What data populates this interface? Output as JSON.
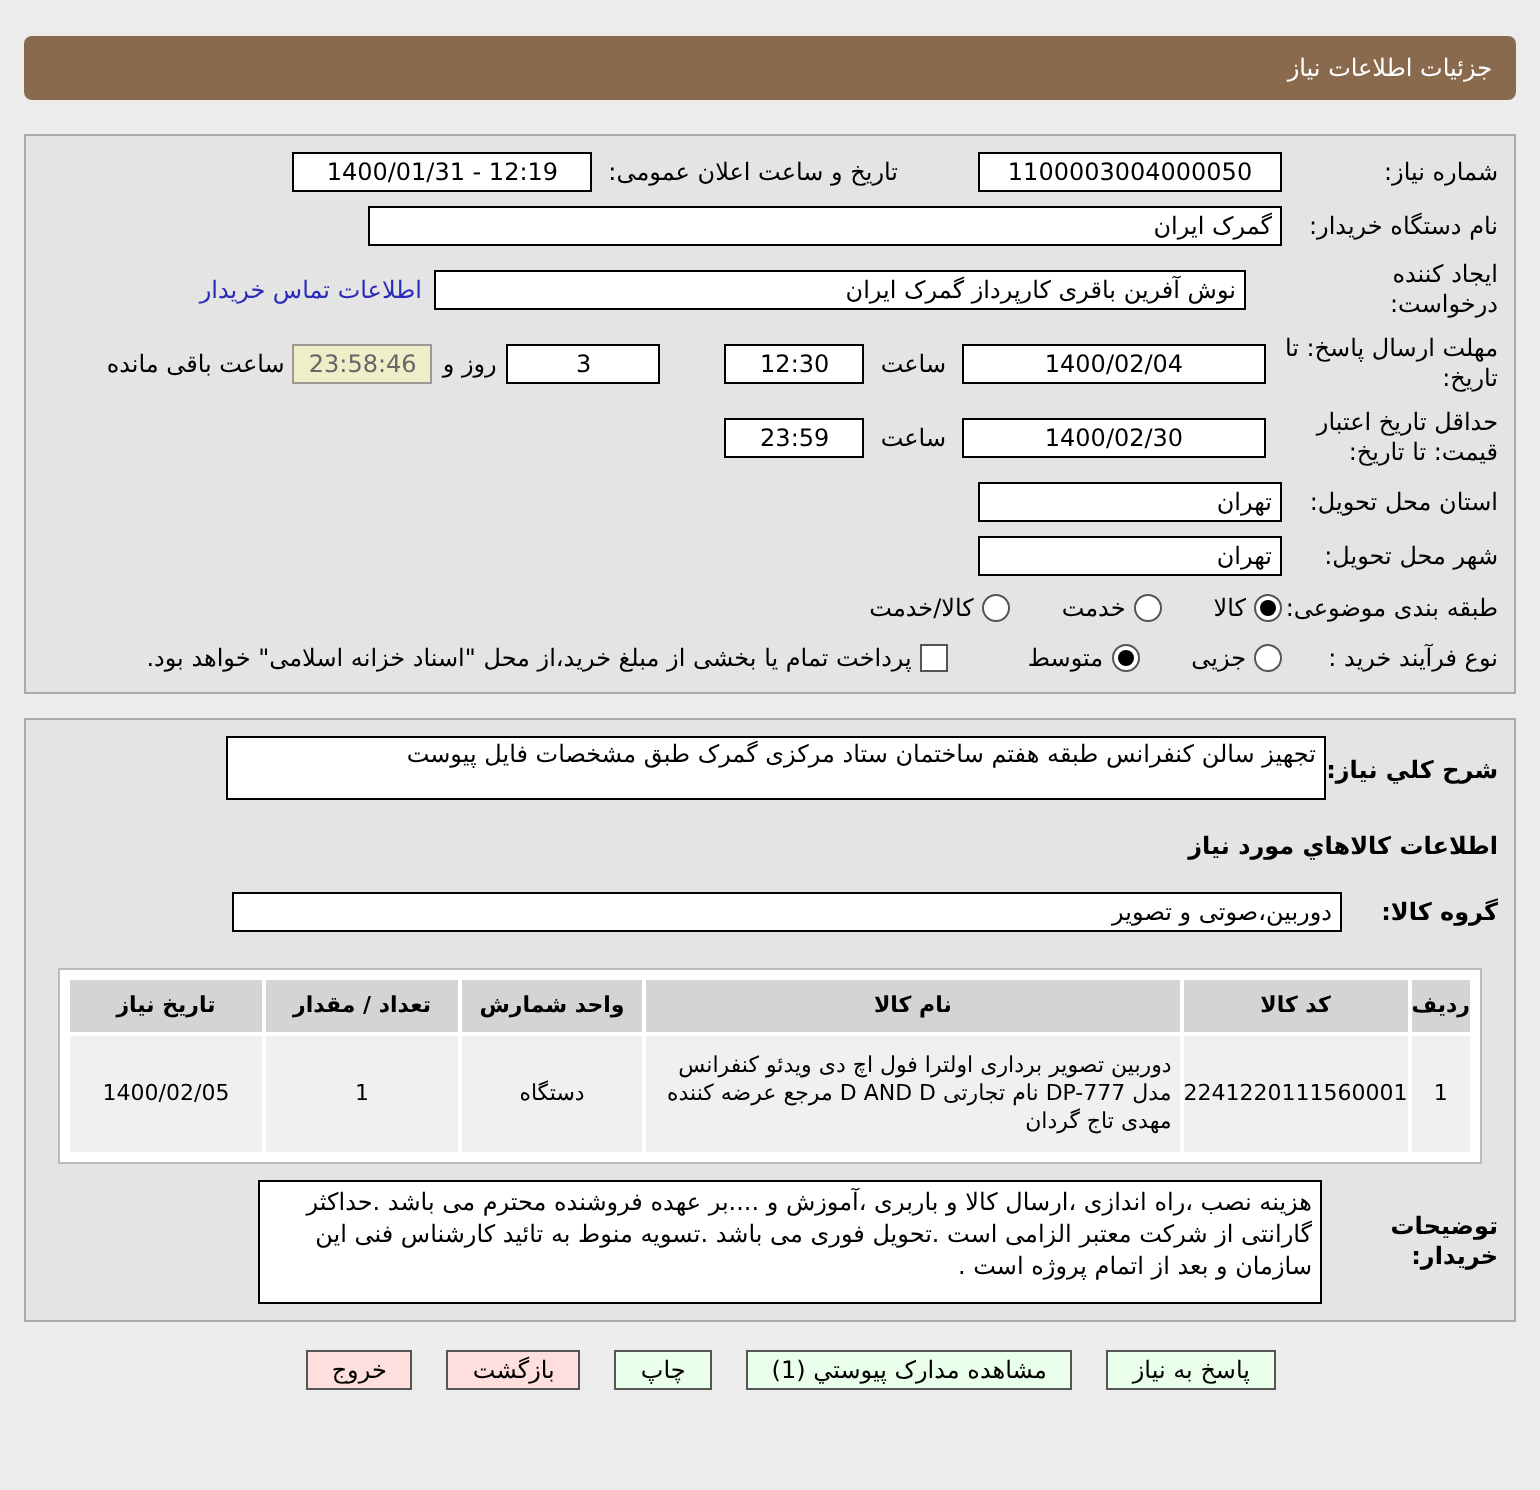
{
  "header": {
    "title": "جزئیات اطلاعات نیاز"
  },
  "need_number": {
    "label": "شماره نیاز:",
    "value": "1100003004000050"
  },
  "announce": {
    "label": "تاریخ و ساعت اعلان عمومی:",
    "value": "1400/01/31 - 12:19"
  },
  "buyer_org": {
    "label": "نام دستگاه خریدار:",
    "value": "گمرک ایران"
  },
  "requester": {
    "label": "ایجاد کننده درخواست:",
    "value": "نوش آفرین باقری کارپرداز گمرک ایران",
    "link": "اطلاعات تماس خریدار"
  },
  "reply_deadline": {
    "label": "مهلت ارسال پاسخ: تا تاریخ:",
    "date": "1400/02/04",
    "time_label": "ساعت",
    "time": "12:30",
    "days": "3",
    "days_label": "روز و",
    "remaining": "23:58:46",
    "remaining_label": "ساعت باقی مانده"
  },
  "price_validity": {
    "label": "حداقل تاریخ اعتبار قیمت: تا تاریخ:",
    "date": "1400/02/30",
    "time_label": "ساعت",
    "time": "23:59"
  },
  "province": {
    "label": "استان محل تحویل:",
    "value": "تهران"
  },
  "city": {
    "label": "شهر محل تحویل:",
    "value": "تهران"
  },
  "category": {
    "label": "طبقه بندی موضوعی:",
    "options": [
      {
        "label": "کالا",
        "selected": true
      },
      {
        "label": "خدمت",
        "selected": false
      },
      {
        "label": "کالا/خدمت",
        "selected": false
      }
    ]
  },
  "purchase_type": {
    "label": "نوع فرآیند خرید :",
    "options": [
      {
        "label": "جزیی",
        "selected": false
      },
      {
        "label": "متوسط",
        "selected": true
      }
    ],
    "payment_note": {
      "label": "پرداخت تمام یا بخشی از مبلغ خرید،از محل \"اسناد خزانه اسلامی\" خواهد بود.",
      "checked": false
    }
  },
  "description": {
    "label": "شرح کلي نياز:",
    "value": "تجهیز سالن کنفرانس طبقه هفتم ساختمان ستاد مرکزی گمرک طبق مشخصات فایل پیوست"
  },
  "goods_heading": "اطلاعات کالاهاي مورد نياز",
  "goods_group": {
    "label": "گروه کالا:",
    "value": "دوربین،صوتی و تصویر"
  },
  "table": {
    "columns": [
      "ردیف",
      "کد کالا",
      "نام کالا",
      "واحد شمارش",
      "تعداد / مقدار",
      "تاریخ نیاز"
    ],
    "rows": [
      [
        "1",
        "2241220111560001",
        "دوربین تصویر برداری اولترا فول اچ دی ویدئو کنفرانس مدل DP-777 نام تجارتی D AND D مرجع عرضه کننده مهدی تاج گردان",
        "دستگاه",
        "1",
        "1400/02/05"
      ]
    ]
  },
  "buyer_notes": {
    "label": "توضیحات خریدار:",
    "value": "هزینه نصب ،راه اندازی ،ارسال کالا و باربری ،آموزش و ....بر عهده فروشنده محترم می باشد .حداکثر گارانتی از شرکت معتبر الزامی است .تحویل فوری می باشد .تسویه منوط به تائید کارشناس فنی این سازمان و بعد از اتمام پروژه است ."
  },
  "buttons": [
    {
      "label": "پاسخ به نیاز",
      "kind": "normal"
    },
    {
      "label": "مشاهده مدارک پیوستي (1)",
      "kind": "normal"
    },
    {
      "label": "چاپ",
      "kind": "normal"
    },
    {
      "label": "بازگشت",
      "kind": "cancel"
    },
    {
      "label": "خروج",
      "kind": "cancel"
    }
  ]
}
